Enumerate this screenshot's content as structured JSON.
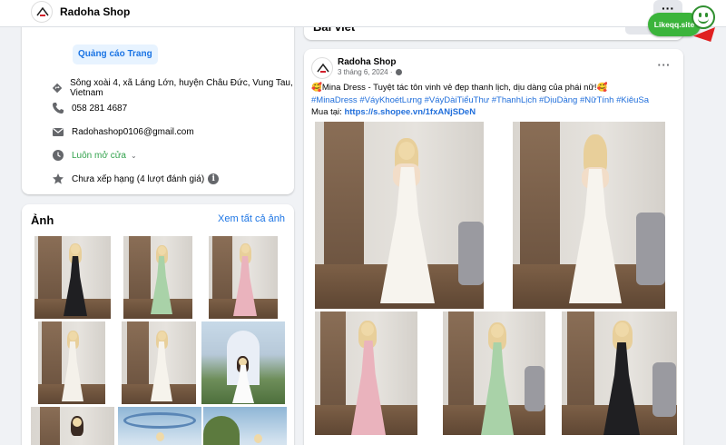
{
  "header": {
    "page_name": "Radoha Shop",
    "more_label": "···"
  },
  "colors": {
    "link": "#216fdb",
    "open_green": "#31a24c",
    "badge_green": "#3bb43b"
  },
  "intro": {
    "ad_button": "Quảng cáo Trang",
    "address": "Sông xoài 4, xã Láng Lớn, huyện Châu Đức, Vung Tau, Vietnam",
    "phone": "058 281 4687",
    "email": "Radohashop0106@gmail.com",
    "hours": "Luôn mở cửa",
    "rating": "Chưa xếp hạng (4 lượt đánh giá)",
    "icons": [
      "location-icon",
      "phone-icon",
      "email-icon",
      "clock-icon",
      "star-icon",
      "info-icon"
    ]
  },
  "photos": {
    "title": "Ảnh",
    "see_all": "Xem tất cả ảnh"
  },
  "posts": {
    "title": "Bài viết"
  },
  "post": {
    "author": "Radoha Shop",
    "date": "3 tháng 6, 2024 ·",
    "more": "···",
    "line1_emoji_left": "🥰",
    "line1_text": "Mina Dress - Tuyệt tác tôn vinh vẻ đẹp thanh lịch, dịu dàng của phái nữ!",
    "line1_emoji_right": "🥰",
    "hashtags": "#MinaDress #VáyKhoétLưng #VáyDàiTiểuThư #ThanhLịch #DịuDàng #NữTính #KiêuSa",
    "buy_label": "Mua tại:",
    "buy_link": "https://s.shopee.vn/1fxANjSDeN"
  },
  "badge": {
    "text": "Likeqq.site"
  }
}
